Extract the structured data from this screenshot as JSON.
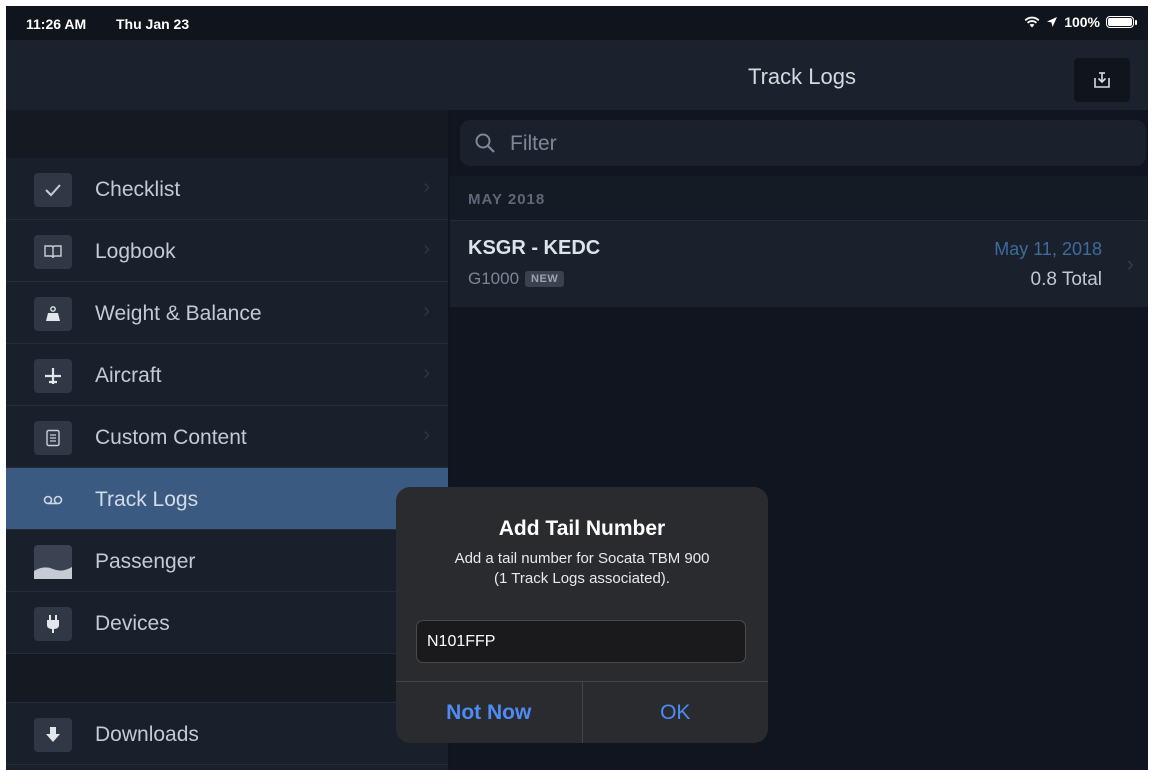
{
  "status": {
    "time": "11:26 AM",
    "date": "Thu Jan 23",
    "battery": "100%"
  },
  "nav": {
    "title": "Track Logs"
  },
  "sidebar": {
    "items": [
      {
        "label": "Checklist",
        "icon": "checkmark-icon"
      },
      {
        "label": "Logbook",
        "icon": "book-icon"
      },
      {
        "label": "Weight & Balance",
        "icon": "weight-icon"
      },
      {
        "label": "Aircraft",
        "icon": "airplane-icon"
      },
      {
        "label": "Custom Content",
        "icon": "document-icon"
      },
      {
        "label": "Track Logs",
        "icon": "track-icon"
      },
      {
        "label": "Passenger",
        "icon": "passenger-icon"
      },
      {
        "label": "Devices",
        "icon": "plug-icon"
      }
    ],
    "downloads": {
      "label": "Downloads",
      "icon": "download-icon"
    }
  },
  "main": {
    "filter_placeholder": "Filter",
    "section": "MAY 2018",
    "log": {
      "route": "KSGR - KEDC",
      "device": "G1000",
      "badge": "NEW",
      "date": "May 11, 2018",
      "total": "0.8 Total"
    }
  },
  "alert": {
    "title": "Add Tail Number",
    "message_line1": "Add a tail number for Socata TBM 900",
    "message_line2": "(1 Track Logs associated).",
    "input_value": "N101FFP",
    "cancel_label": "Not Now",
    "ok_label": "OK"
  },
  "colors": {
    "accent": "#4f8bf5",
    "selected_row": "#3a5a82",
    "background": "#0f1420"
  }
}
